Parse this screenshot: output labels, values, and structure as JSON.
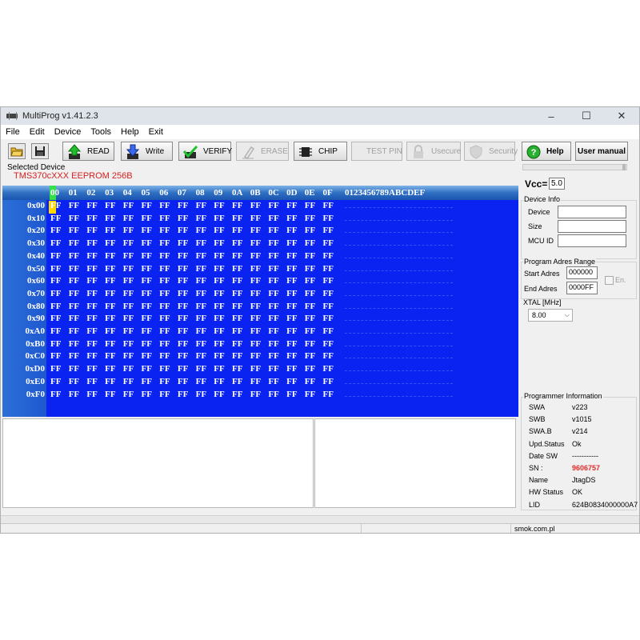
{
  "window": {
    "title": "MultiProg v1.41.2.3"
  },
  "menu": [
    "File",
    "Edit",
    "Device",
    "Tools",
    "Help",
    "Exit"
  ],
  "toolbar": {
    "read": "READ",
    "write": "Write",
    "verify": "VERIFY",
    "erase": "ERASE",
    "chip": "CHIP",
    "test_pin": "TEST PIN",
    "usecure": "Usecure",
    "security": "Security",
    "help": "Help",
    "user_manual": "User manual"
  },
  "selected_device": {
    "label": "Selected Device",
    "value": "TMS370cXXX EEPROM 256B"
  },
  "vcc": {
    "label": "Vcc=",
    "value": "5.0"
  },
  "hex": {
    "col_headers": [
      "00",
      "01",
      "02",
      "03",
      "04",
      "05",
      "06",
      "07",
      "08",
      "09",
      "0A",
      "0B",
      "0C",
      "0D",
      "0E",
      "0F"
    ],
    "ascii_header": "0123456789ABCDEF",
    "row_addresses": [
      "0x00",
      "0x10",
      "0x20",
      "0x30",
      "0x40",
      "0x50",
      "0x60",
      "0x70",
      "0x80",
      "0x90",
      "0xA0",
      "0xB0",
      "0xC0",
      "0xD0",
      "0xE0",
      "0xF0"
    ],
    "cell_value": "FF"
  },
  "device_info": {
    "title": "Device Info",
    "device_label": "Device",
    "size_label": "Size",
    "mcu_label": "MCU ID"
  },
  "program_range": {
    "title": "Program Adres Range",
    "start_label": "Start Adres",
    "start_value": "000000",
    "end_label": "End Adres",
    "end_value": "0000FF",
    "en_label": "En."
  },
  "xtal": {
    "label": "XTAL [MHz]",
    "value": "8.00"
  },
  "programmer_info": {
    "title": "Programmer Information",
    "rows": [
      {
        "label": "SWA",
        "value": "v223"
      },
      {
        "label": "SWB",
        "value": "v1015"
      },
      {
        "label": "SWA.B",
        "value": "v214"
      },
      {
        "label": "Upd.Status",
        "value": "Ok"
      },
      {
        "label": "Date  SW",
        "value": "-----------"
      },
      {
        "label": "SN :",
        "value": "9606757"
      },
      {
        "label": "Name",
        "value": "JtagDS"
      },
      {
        "label": "HW Status",
        "value": "OK"
      },
      {
        "label": "LID",
        "value": "624B0834000000A7"
      }
    ]
  },
  "status": {
    "site": "smok.com.pl"
  },
  "colors": {
    "hex_bg": "#0a23f0",
    "accent_red": "#e22a2a",
    "highlight": "#ffd800"
  }
}
